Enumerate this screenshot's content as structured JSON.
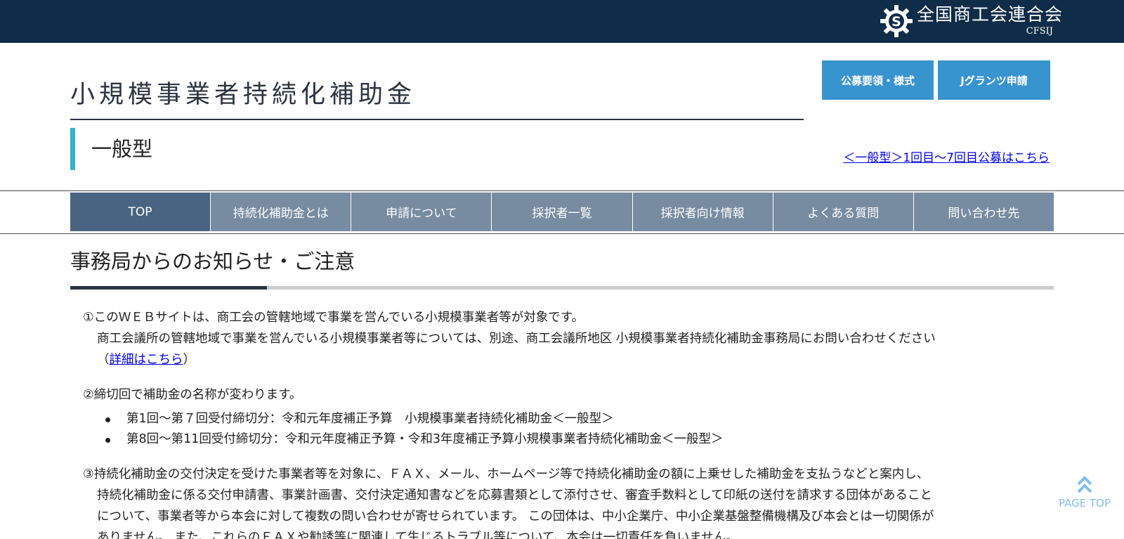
{
  "header": {
    "org_name": "全国商工会連合会",
    "org_abbr": "CFSIJ",
    "logo_icon": "gear-s-logo-icon",
    "site_title": "小規模事業者持続化補助金",
    "sub_title": "一般型",
    "buttons": [
      "公募要領・様式",
      "Jグランツ申請"
    ],
    "past_link": "＜一般型＞1回目〜7回目公募はこちら",
    "colors": {
      "topbar": "#0f2c48",
      "button": "#3894cf",
      "accent_bar": "#2fb3c9"
    }
  },
  "nav": {
    "items": [
      "TOP",
      "持続化補助金とは",
      "申請について",
      "採択者一覧",
      "採択者向け情報",
      "よくある質問",
      "問い合わせ先"
    ],
    "active": "TOP",
    "colors": {
      "item": "#778ca1",
      "active": "#496480"
    }
  },
  "main": {
    "section_title": "事務局からのお知らせ・ご注意",
    "notice1": {
      "line1": "①このＷＥＢサイトは、商工会の管轄地域で事業を営んでいる小規模事業者等が対象です。",
      "line2": "商工会議所の管轄地域で事業を営んでいる小規模事業者等については、別途、商工会議所地区 小規模事業者持続化補助金事務局にお問い合わせください",
      "paren_open": "（",
      "link": "詳細はこちら",
      "paren_close": "）"
    },
    "notice2": {
      "line1": "②締切回で補助金の名称が変わります。",
      "bullets": [
        "第1回〜第７回受付締切分：令和元年度補正予算　小規模事業者持続化補助金＜一般型＞",
        "第8回〜第11回受付締切分：令和元年度補正予算・令和3年度補正予算小規模事業者持続化補助金＜一般型＞"
      ]
    },
    "notice3": {
      "line1": "③持続化補助金の交付決定を受けた事業者等を対象に、ＦＡＸ、メール、ホームページ等で持続化補助金の額に上乗せした補助金を支払うなどと案内し、",
      "line2": "持続化補助金に係る交付申請書、事業計画書、交付決定通知書などを応募書類として添付させ、審査手数料として印紙の送付を請求する団体があること",
      "line3": "について、事業者等から本会に対して複数の問い合わせが寄せられています。 この団体は、中小企業庁、中小企業基盤整備機構及び本会とは一切関係が",
      "line4": "ありません。 また、これらのＦＡＸや勧誘等に関連して生じるトラブル等について、本会は一切責任を負いません。"
    }
  },
  "page_top": {
    "label": "PAGE TOP",
    "icon": "double-chevron-up-icon"
  }
}
